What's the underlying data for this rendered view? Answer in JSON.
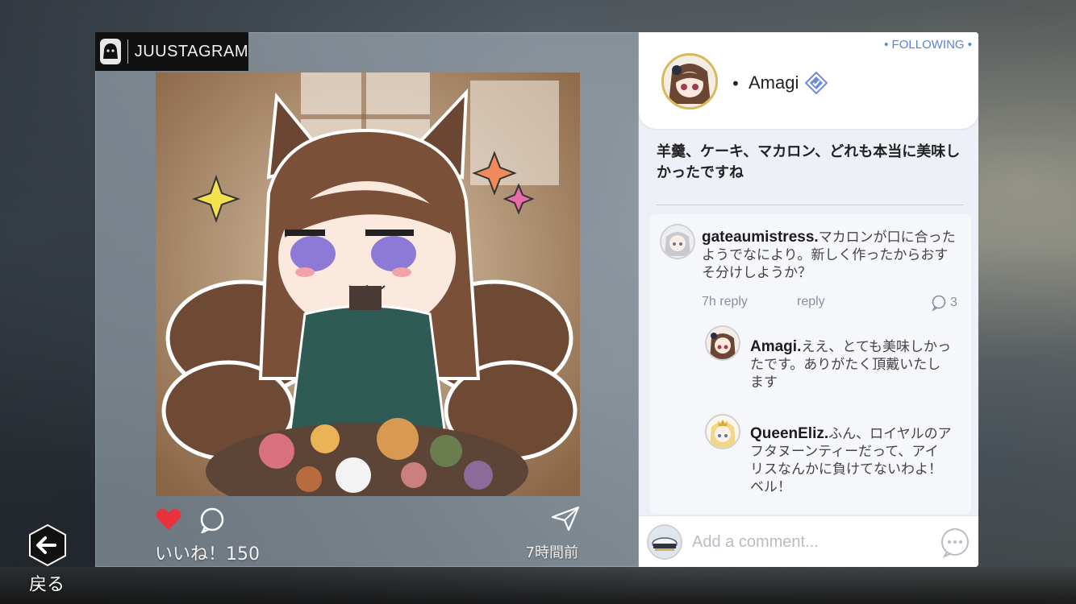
{
  "app": {
    "brand_name": "JUUSTAGRAM"
  },
  "post": {
    "likes_text": "いいね！150",
    "time_ago": "7時間前",
    "liked_color": "#e8333f"
  },
  "back": {
    "label": "戻る"
  },
  "profile": {
    "following_label": "• FOLLOWING •",
    "bullet": "•",
    "name": "Amagi",
    "verified_color": "#6b8be0"
  },
  "caption": "羊羹、ケーキ、マカロン、どれも本当に美味しかったですね",
  "comments": [
    {
      "user": "gateaumistress.",
      "text": "マカロンが口に合ったようでなにより。新しく作ったからおすそ分けしようか？",
      "time_reply": "7h reply",
      "reply_label": "reply",
      "reply_count": "3"
    },
    {
      "user": "Amagi.",
      "text": "ええ、とても美味しかったです。ありがたく頂戴いたします"
    },
    {
      "user": "QueenEliz.",
      "text": "ふん、ロイヤルのアフタヌーンティーだって、アイリスなんかに負けてないわよ！ベル！"
    }
  ],
  "add_comment": {
    "placeholder": "Add a comment..."
  }
}
